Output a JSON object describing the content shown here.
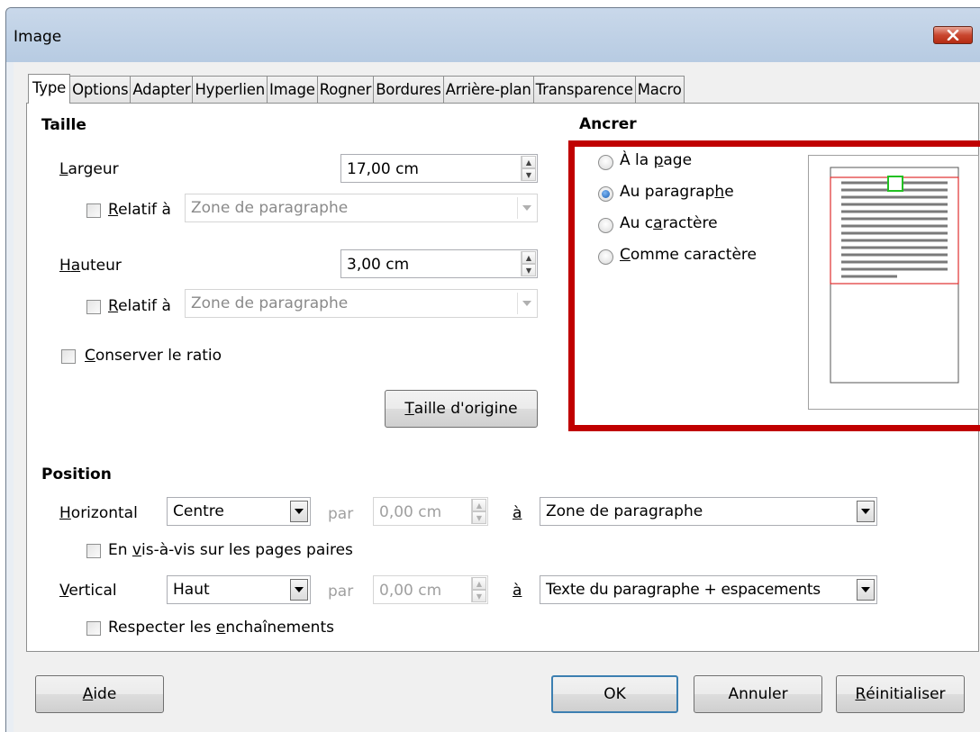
{
  "window": {
    "title": "Image"
  },
  "tabs": [
    {
      "label": "Type"
    },
    {
      "label": "Options"
    },
    {
      "label": "Adapter"
    },
    {
      "label": "Hyperlien"
    },
    {
      "label": "Image"
    },
    {
      "label": "Rogner"
    },
    {
      "label": "Bordures"
    },
    {
      "label": "Arrière-plan"
    },
    {
      "label": "Transparence"
    },
    {
      "label": "Macro"
    }
  ],
  "size": {
    "heading": "Taille",
    "width_label_pre": "L",
    "width_label_rest": "argeur",
    "width_value": "17,00 cm",
    "width_relative_label_pre": "R",
    "width_relative_label_rest": "elatif à",
    "width_relative_to": "Zone de paragraphe",
    "height_label_pre": "H",
    "height_label_u": "a",
    "height_label_rest": "uteur",
    "height_value": "3,00 cm",
    "height_relative_label_pre": "R",
    "height_relative_label_rest": "elatif à",
    "height_relative_to": "Zone de paragraphe",
    "keep_ratio_pre": "C",
    "keep_ratio_rest": "onserver le ratio",
    "original_size_pre": "T",
    "original_size_rest": "aille d'origine"
  },
  "anchor": {
    "heading": "Ancrer",
    "options": [
      {
        "pre": "À la ",
        "u": "p",
        "post": "age",
        "checked": false
      },
      {
        "pre": "Au paragrap",
        "u": "h",
        "post": "e",
        "checked": true
      },
      {
        "pre": "Au c",
        "u": "a",
        "post": "ractère",
        "checked": false
      },
      {
        "pre": "",
        "u": "C",
        "post": "omme caractère",
        "checked": false
      }
    ]
  },
  "position": {
    "heading": "Position",
    "horizontal_pre": "H",
    "horizontal_rest": "orizontal",
    "horizontal_value": "Centre",
    "horizontal_by": "par",
    "horizontal_by_value": "0,00 cm",
    "horizontal_to": "à",
    "horizontal_to_value": "Zone de paragraphe",
    "mirror_pre": "En ",
    "mirror_u": "v",
    "mirror_rest": "is-à-vis sur les pages paires",
    "vertical_pre": "V",
    "vertical_rest": "ertical",
    "vertical_value": "Haut",
    "vertical_by": "par",
    "vertical_by_value": "0,00 cm",
    "vertical_to": "à",
    "vertical_to_value": "Texte du paragraphe + espacements",
    "follow_pre": "Respecter les ",
    "follow_u": "e",
    "follow_rest": "nchaînements"
  },
  "buttons": {
    "help_pre": "A",
    "help_rest": "ide",
    "ok": "OK",
    "cancel": "Annuler",
    "reset_pre": "R",
    "reset_rest": "éinitialiser"
  },
  "colors": {
    "highlight": "#c00000",
    "preview_frame": "#e03030",
    "anchor_marker": "#22c022"
  }
}
